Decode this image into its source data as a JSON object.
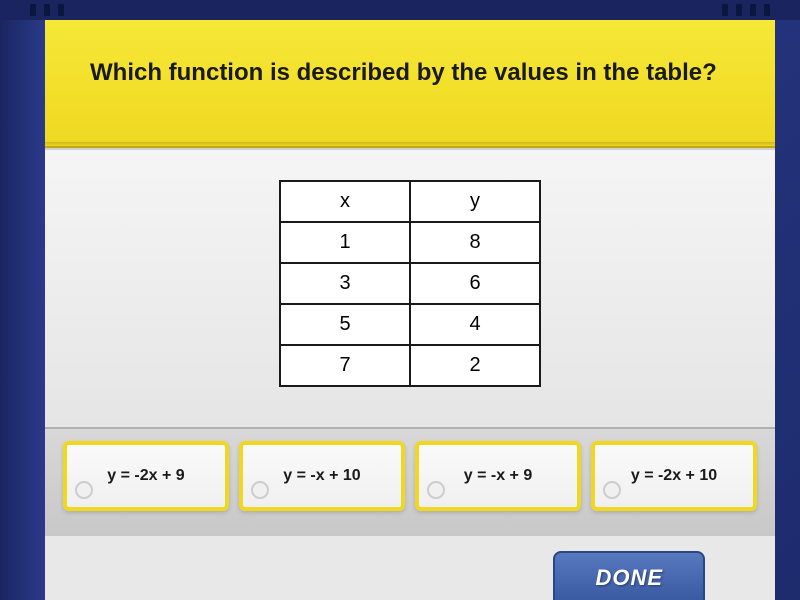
{
  "question": {
    "text": "Which function is described by the values in the table?"
  },
  "table": {
    "headers": {
      "col1": "x",
      "col2": "y"
    },
    "rows": [
      {
        "x": "1",
        "y": "8"
      },
      {
        "x": "3",
        "y": "6"
      },
      {
        "x": "5",
        "y": "4"
      },
      {
        "x": "7",
        "y": "2"
      }
    ]
  },
  "answers": [
    {
      "label": "y = -2x + 9"
    },
    {
      "label": "y = -x + 10"
    },
    {
      "label": "y = -x + 9"
    },
    {
      "label": "y = -2x + 10"
    }
  ],
  "done_button": {
    "label": "DONE"
  }
}
